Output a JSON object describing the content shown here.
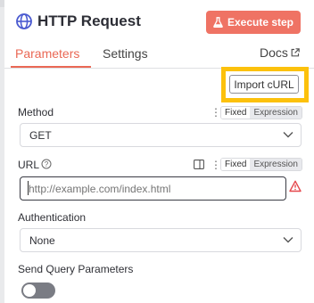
{
  "header": {
    "title": "HTTP Request",
    "execute_label": "Execute step"
  },
  "tabs": {
    "parameters": "Parameters",
    "settings": "Settings",
    "docs": "Docs"
  },
  "import_curl_label": "Import cURL",
  "method": {
    "label": "Method",
    "value": "GET",
    "fixed": "Fixed",
    "expression": "Expression"
  },
  "url": {
    "label": "URL",
    "placeholder": "http://example.com/index.html",
    "fixed": "Fixed",
    "expression": "Expression"
  },
  "authentication": {
    "label": "Authentication",
    "value": "None"
  },
  "send_query": {
    "label": "Send Query Parameters"
  },
  "colors": {
    "accent": "#ea6855",
    "execute_bg": "#ef7364",
    "highlight": "#fcc10c",
    "error": "#e5484d"
  },
  "icons": [
    "globe-icon",
    "flask-icon",
    "external-link-icon",
    "more-vertical-icon",
    "help-circle-icon",
    "panel-icon",
    "chevron-down-icon",
    "warning-icon"
  ]
}
